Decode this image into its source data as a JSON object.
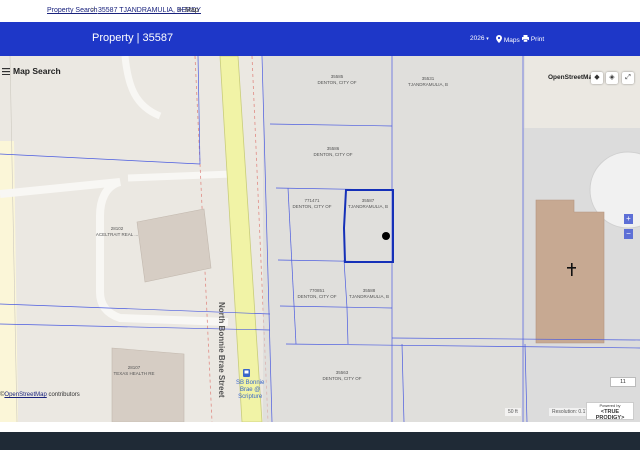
{
  "breadcrumb": {
    "items": [
      "Property Search",
      "35587 TJANDRAMULIA, BERDY",
      "Map"
    ],
    "separator": ">"
  },
  "header": {
    "title": "Property | 35587",
    "year": "2026",
    "maps_label": "Maps",
    "print_label": "Print",
    "color": "#1e37c8"
  },
  "map": {
    "search_title": "Map Search",
    "layer_name": "OpenStreetMap",
    "street_name": "North Bonnie Brae Street",
    "bus_stop": [
      "SB Bonnie",
      "Brae @",
      "Scripture"
    ],
    "parcels": {
      "p1": [
        "35585",
        "DENTON, CITY OF"
      ],
      "p2": [
        "35531",
        "TJANDRAMULIA, B"
      ],
      "p3": [
        "35586",
        "DENTON, CITY OF"
      ],
      "p4": [
        "771471",
        "DENTON, CITY OF"
      ],
      "p5": [
        "35587",
        "TJANDRAMULIA, B"
      ],
      "p6": [
        "770851",
        "DENTON, CITY OF"
      ],
      "p7": [
        "35588",
        "TJANDRAMULIA, B"
      ],
      "p8": [
        "35563",
        "DENTON, CITY OF"
      ],
      "p9": [
        "28102",
        "ACELTRAIT REAL ..."
      ],
      "p10": [
        "28107",
        "TEXAS HEALTH RE"
      ]
    },
    "zoom_in": "+",
    "zoom_out": "−",
    "zoom_level": "11",
    "scale_text": "50 ft",
    "resolution_text": "Resolution: 0.17",
    "attribution_prefix": "©",
    "attribution_link": "OpenStreetMap",
    "attribution_suffix": "contributors",
    "powered_by": "Powered by",
    "powered_brand": "<TRUE PRODIGY>",
    "selected_color": "#1530b8",
    "parcel_line_color": "#4a5be0"
  }
}
